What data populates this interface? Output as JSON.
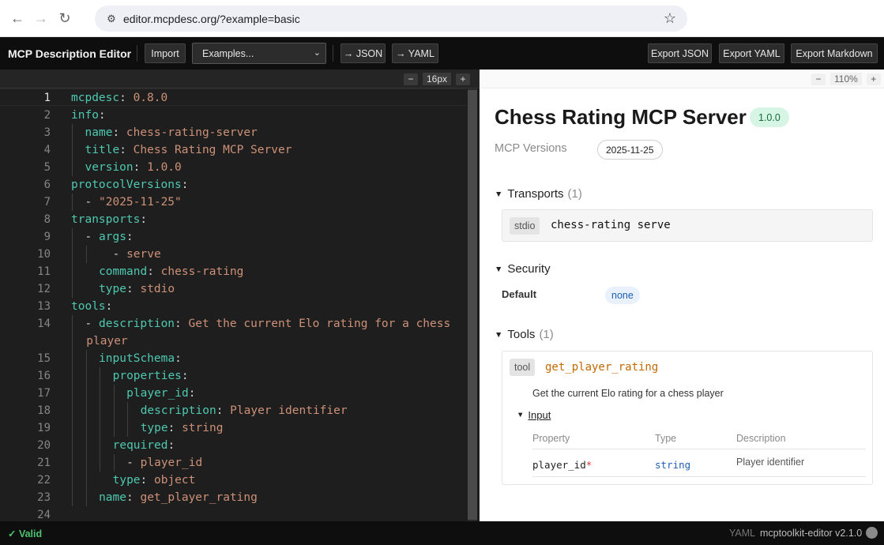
{
  "browser": {
    "url": "editor.mcpdesc.org/?example=basic"
  },
  "app": {
    "title": "MCP Description Editor",
    "import_label": "Import",
    "examples_label": "Examples...",
    "to_json_label": "→ JSON",
    "to_yaml_label": "→ YAML",
    "export_json_label": "Export JSON",
    "export_yaml_label": "Export YAML",
    "export_markdown_label": "Export Markdown"
  },
  "editor": {
    "font_size": "16px",
    "minus": "−",
    "plus": "+",
    "active_line": 1,
    "lines": [
      {
        "n": "1",
        "key": "mcpdesc",
        "val": "0.8.0"
      },
      {
        "n": "2",
        "key": "info"
      },
      {
        "n": "3",
        "key": "name",
        "val": "chess-rating-server"
      },
      {
        "n": "4",
        "key": "title",
        "val": "Chess Rating MCP Server"
      },
      {
        "n": "5",
        "key": "version",
        "val": "1.0.0"
      },
      {
        "n": "6",
        "key": "protocolVersions"
      },
      {
        "n": "7",
        "item": "\"2025-11-25\""
      },
      {
        "n": "8",
        "key": "transports"
      },
      {
        "n": "9",
        "key": "args"
      },
      {
        "n": "10",
        "item": "serve"
      },
      {
        "n": "11",
        "key": "command",
        "val": "chess-rating"
      },
      {
        "n": "12",
        "key": "type",
        "val": "stdio"
      },
      {
        "n": "13",
        "key": "tools"
      },
      {
        "n": "14",
        "key": "description",
        "val": "Get the current Elo rating for a chess"
      },
      {
        "n": "",
        "wrap": "player"
      },
      {
        "n": "15",
        "key": "inputSchema"
      },
      {
        "n": "16",
        "key": "properties"
      },
      {
        "n": "17",
        "key": "player_id"
      },
      {
        "n": "18",
        "key": "description",
        "val": "Player identifier"
      },
      {
        "n": "19",
        "key": "type",
        "val": "string"
      },
      {
        "n": "20",
        "key": "required"
      },
      {
        "n": "21",
        "item": "player_id"
      },
      {
        "n": "22",
        "key": "type",
        "val": "object"
      },
      {
        "n": "23",
        "key": "name",
        "val": "get_player_rating"
      },
      {
        "n": "24"
      }
    ]
  },
  "preview": {
    "zoom": "110%",
    "minus": "−",
    "plus": "+",
    "title": "Chess Rating MCP Server",
    "version_badge": "1.0.0",
    "mcp_versions_label": "MCP Versions",
    "mcp_version": "2025-11-25",
    "transports_label": "Transports",
    "transports_count": "(1)",
    "transport_tag": "stdio",
    "transport_command": "chess-rating serve",
    "security_label": "Security",
    "security_default_label": "Default",
    "security_default_value": "none",
    "tools_label": "Tools",
    "tools_count": "(1)",
    "tool_tag": "tool",
    "tool_name": "get_player_rating",
    "tool_description": "Get the current Elo rating for a chess player",
    "input_label": "Input",
    "table_headers": {
      "property": "Property",
      "type": "Type",
      "description": "Description"
    },
    "table_rows": [
      {
        "property": "player_id",
        "required_mark": "*",
        "type": "string",
        "description": "Player identifier"
      }
    ]
  },
  "status": {
    "valid": "✓ Valid",
    "format": "YAML",
    "version": "mcptoolkit-editor v2.1.0"
  },
  "colors": {
    "yaml_key": "#4ec9b0",
    "yaml_value": "#ce9178",
    "valid_green": "#4cc36f",
    "tool_name": "#c26a00",
    "version_badge_bg": "#d7f5e4"
  },
  "icons": [
    "back-arrow-icon",
    "forward-arrow-icon",
    "reload-icon",
    "site-settings-icon",
    "bookmark-star-icon",
    "chevron-down-icon",
    "collapse-triangle-icon",
    "github-icon"
  ]
}
